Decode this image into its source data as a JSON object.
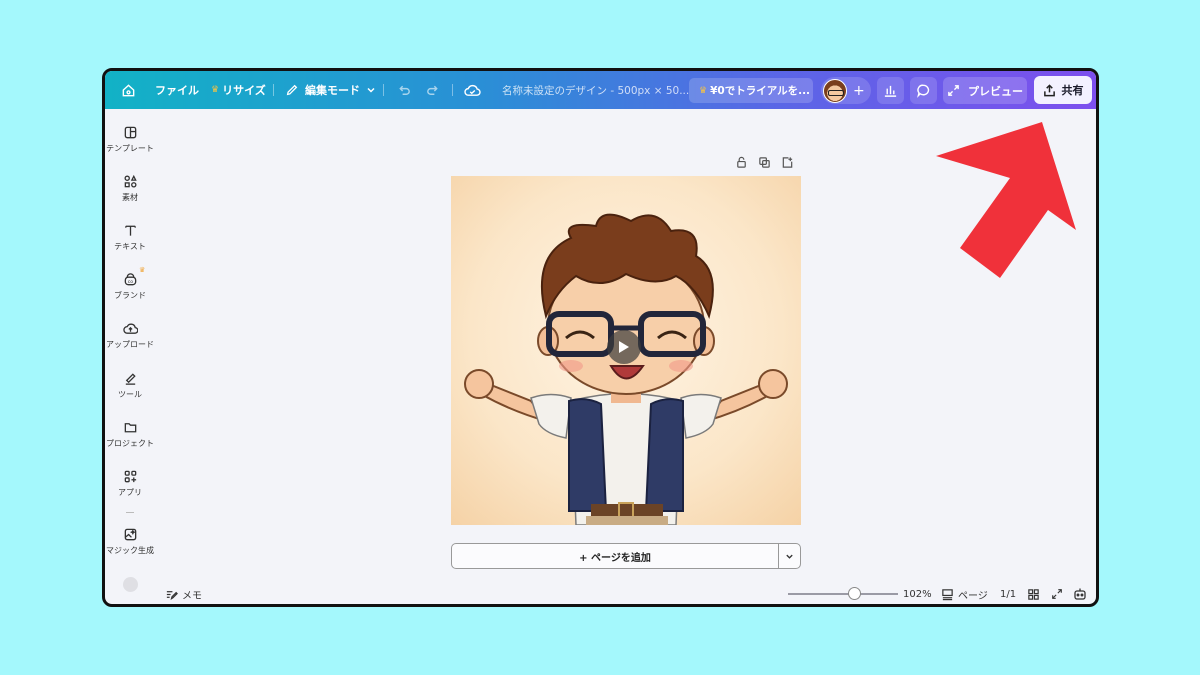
{
  "topbar": {
    "file_label": "ファイル",
    "resize_label": "リサイズ",
    "edit_mode_label": "編集モード",
    "doc_title": "名称未設定のデザイン - 500px × 50...",
    "trial_label": "¥0でトライアルを...",
    "preview_label": "プレビュー",
    "share_label": "共有",
    "add_collaborator": "+"
  },
  "sidebar": {
    "items": [
      {
        "label": "テンプレート",
        "icon": "template-icon"
      },
      {
        "label": "素材",
        "icon": "elements-icon"
      },
      {
        "label": "テキスト",
        "icon": "text-icon"
      },
      {
        "label": "ブランド",
        "icon": "brand-icon"
      },
      {
        "label": "アップロード",
        "icon": "upload-icon"
      },
      {
        "label": "ツール",
        "icon": "tools-icon"
      },
      {
        "label": "プロジェクト",
        "icon": "folder-icon"
      },
      {
        "label": "アプリ",
        "icon": "apps-icon"
      },
      {
        "label": "マジック生成",
        "icon": "magic-icon"
      }
    ]
  },
  "canvas": {
    "add_page_label": "+ ページを追加"
  },
  "bottombar": {
    "notes_label": "メモ",
    "zoom_value": "102%",
    "zoom_fraction": 0.6,
    "pages_label": "ページ",
    "page_count": "1/1"
  },
  "colors": {
    "page_background": "#a4f8fc",
    "topbar_start": "#12b2c6",
    "topbar_end": "#7d4fee",
    "arrow": "#f0313a",
    "crown": "#f6c343"
  }
}
